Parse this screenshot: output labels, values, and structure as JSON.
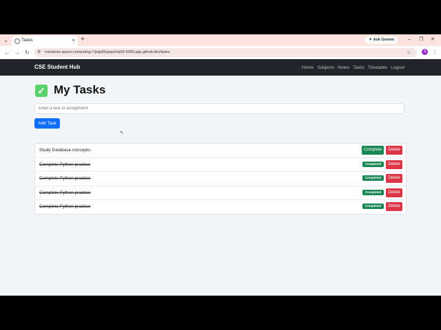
{
  "browser": {
    "tab_title": "Tasks",
    "url": "miniature-space-computing-r7prjp65xpqw2wj56-5000.app.github.dev/tasks",
    "gemini_label": "Ask Gemini",
    "profile_initial": "S"
  },
  "navbar": {
    "brand": "CSE Student Hub",
    "links": [
      "Home",
      "Subjects",
      "Notes",
      "Tasks",
      "Timetable",
      "Logout"
    ]
  },
  "page": {
    "title": "My Tasks",
    "input_placeholder": "Enter a task or assignment",
    "add_button": "Add Task"
  },
  "tasks": [
    {
      "text": "Study Database concepts",
      "action": "Complete",
      "delete": "Delete"
    },
    {
      "text": "Complete Python practice",
      "status": "Completed",
      "delete": "Delete"
    },
    {
      "text": "Complete Python practice",
      "status": "Completed",
      "delete": "Delete"
    },
    {
      "text": "Complete Python practice",
      "status": "Completed",
      "delete": "Delete"
    },
    {
      "text": "Complete Python practice",
      "status": "Completed",
      "delete": "Delete"
    }
  ],
  "colors": {
    "navbar_bg": "#212529",
    "primary": "#0d6efd",
    "success": "#198754",
    "danger": "#dc3545"
  }
}
